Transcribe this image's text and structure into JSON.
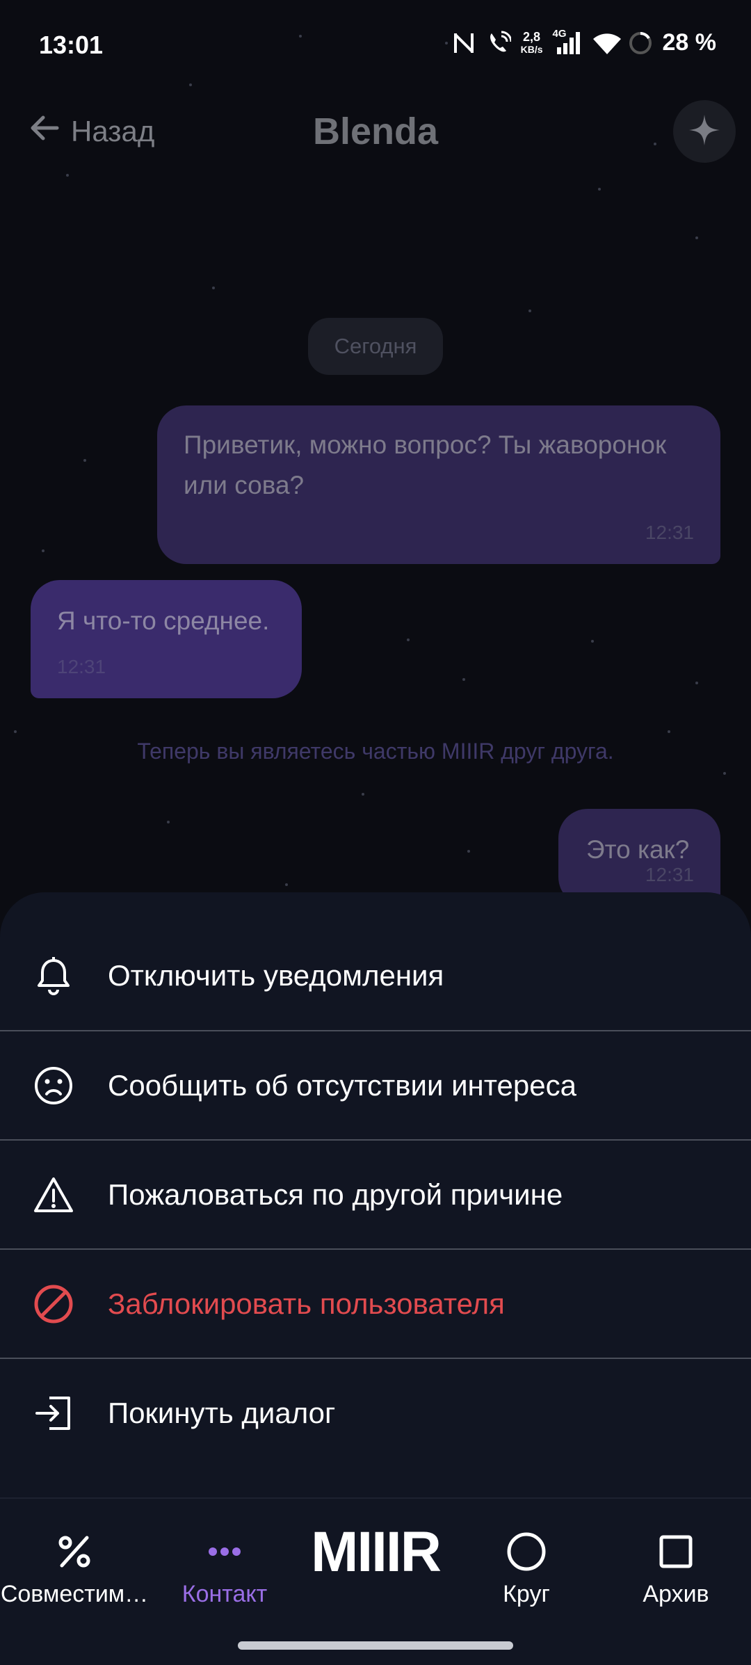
{
  "status_bar": {
    "time": "13:01",
    "net_speed_value": "2,8",
    "net_speed_unit": "KB/s",
    "network_type": "4G",
    "battery": "28 %"
  },
  "header": {
    "back_label": "Назад",
    "title": "Blenda"
  },
  "chat": {
    "date_chip": "Сегодня",
    "messages": [
      {
        "direction": "outgoing",
        "text": "Приветик, можно вопрос? Ты жаворонок или сова?",
        "time": "12:31"
      },
      {
        "direction": "incoming",
        "text": "Я что-то среднее.",
        "time": "12:31"
      },
      {
        "direction": "outgoing",
        "text": "Это как?",
        "time": "12:31"
      }
    ],
    "system_note": "Теперь вы являетесь частью MIIIR друг друга."
  },
  "action_sheet": {
    "items": [
      {
        "label": "Отключить уведомления",
        "icon": "bell-icon"
      },
      {
        "label": "Сообщить об отсутствии интереса",
        "icon": "sad-face-icon"
      },
      {
        "label": "Пожаловаться по другой причине",
        "icon": "warning-icon"
      },
      {
        "label": "Заблокировать пользователя",
        "icon": "block-icon",
        "color": "#e24b4f"
      },
      {
        "label": "Покинуть диалог",
        "icon": "exit-icon"
      }
    ]
  },
  "bottom_nav": {
    "items": [
      {
        "label": "Совместим…",
        "icon": "percent-icon"
      },
      {
        "label": "Контакт",
        "icon": "dots-icon",
        "active": true
      },
      {
        "label": "Круг",
        "icon": "circle-icon"
      },
      {
        "label": "Архив",
        "icon": "square-icon"
      }
    ],
    "logo": "MIIIR"
  },
  "colors": {
    "background": "#0b0c12",
    "sheet": "#111522",
    "accent": "#9a6ee6",
    "danger": "#e24b4f",
    "bubble_outgoing": "#2e2550",
    "bubble_incoming": "#3a2b6c"
  }
}
